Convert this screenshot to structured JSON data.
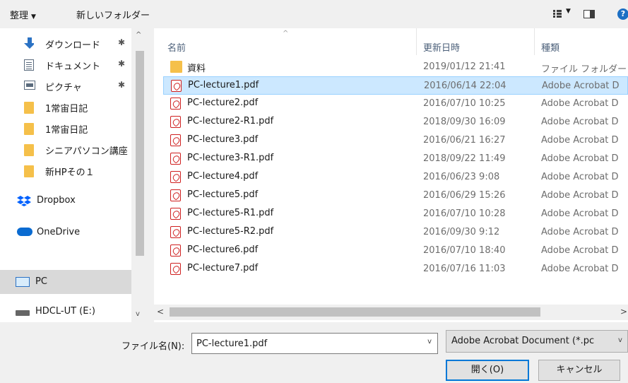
{
  "toolbar": {
    "organize_label": "整理",
    "organize_caret": "▼",
    "new_folder_label": "新しいフォルダー",
    "view_caret": "▼",
    "help_glyph": "?"
  },
  "nav": {
    "items": [
      {
        "label": "ダウンロード",
        "icon": "download-arrow-icon",
        "pinned": true
      },
      {
        "label": "ドキュメント",
        "icon": "document-icon",
        "pinned": true
      },
      {
        "label": "ピクチャ",
        "icon": "picture-icon",
        "pinned": true
      },
      {
        "label": "1常宙日記",
        "icon": "folder-icon",
        "pinned": false
      },
      {
        "label": "1常宙日記",
        "icon": "folder-icon",
        "pinned": false
      },
      {
        "label": "シニアパソコン講座",
        "icon": "folder-icon",
        "pinned": false
      },
      {
        "label": "新HPその１",
        "icon": "folder-icon",
        "pinned": false
      },
      {
        "label": "Dropbox",
        "icon": "dropbox-icon",
        "pinned": false
      },
      {
        "label": "OneDrive",
        "icon": "cloud-icon",
        "pinned": false
      },
      {
        "label": "PC",
        "icon": "computer-icon",
        "pinned": false,
        "selected": true
      },
      {
        "label": "HDCL-UT (E:)",
        "icon": "drive-icon",
        "pinned": false
      }
    ],
    "pin_glyph": "📌",
    "up_glyph": "^",
    "down_glyph": "v"
  },
  "list": {
    "columns": {
      "name": "名前",
      "date": "更新日時",
      "type": "種類"
    },
    "sort_glyph": "^",
    "rows": [
      {
        "name": "資料",
        "date": "2019/01/12 21:41",
        "type": "ファイル フォルダー",
        "kind": "folder"
      },
      {
        "name": "PC-lecture1.pdf",
        "date": "2016/06/14 22:04",
        "type": "Adobe Acrobat D",
        "kind": "pdf",
        "selected": true
      },
      {
        "name": "PC-lecture2.pdf",
        "date": "2016/07/10 10:25",
        "type": "Adobe Acrobat D",
        "kind": "pdf"
      },
      {
        "name": "PC-lecture2-R1.pdf",
        "date": "2018/09/30 16:09",
        "type": "Adobe Acrobat D",
        "kind": "pdf"
      },
      {
        "name": "PC-lecture3.pdf",
        "date": "2016/06/21 16:27",
        "type": "Adobe Acrobat D",
        "kind": "pdf"
      },
      {
        "name": "PC-lecture3-R1.pdf",
        "date": "2018/09/22 11:49",
        "type": "Adobe Acrobat D",
        "kind": "pdf"
      },
      {
        "name": "PC-lecture4.pdf",
        "date": "2016/06/23 9:08",
        "type": "Adobe Acrobat D",
        "kind": "pdf"
      },
      {
        "name": "PC-lecture5.pdf",
        "date": "2016/06/29 15:26",
        "type": "Adobe Acrobat D",
        "kind": "pdf"
      },
      {
        "name": "PC-lecture5-R1.pdf",
        "date": "2016/07/10 10:28",
        "type": "Adobe Acrobat D",
        "kind": "pdf"
      },
      {
        "name": "PC-lecture5-R2.pdf",
        "date": "2016/09/30 9:12",
        "type": "Adobe Acrobat D",
        "kind": "pdf"
      },
      {
        "name": "PC-lecture6.pdf",
        "date": "2016/07/10 18:40",
        "type": "Adobe Acrobat D",
        "kind": "pdf"
      },
      {
        "name": "PC-lecture7.pdf",
        "date": "2016/07/16 11:03",
        "type": "Adobe Acrobat D",
        "kind": "pdf"
      }
    ],
    "scroll_left_glyph": "<",
    "scroll_right_glyph": ">"
  },
  "bottom": {
    "filename_label": "ファイル名(N):",
    "filename_value": "PC-lecture1.pdf",
    "filename_dropdown_glyph": "v",
    "filetype_value": "Adobe Acrobat Document (*.pc",
    "filetype_dropdown_glyph": "v",
    "open_label": "開く(O)",
    "cancel_label": "キャンセル"
  },
  "colors": {
    "selection_bg": "#cce8ff",
    "selection_border": "#99d1ff",
    "accent": "#0078d7",
    "pdf_red": "#cf1f1f",
    "folder_yellow": "#f5c04a"
  }
}
